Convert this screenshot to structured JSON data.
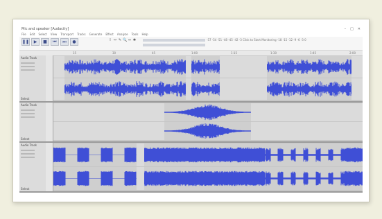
{
  "app": {
    "title": "Mic and speaker [Audacity]",
    "window_buttons": [
      "–",
      "□",
      "✕"
    ]
  },
  "menu": [
    "File",
    "Edit",
    "Select",
    "View",
    "Transport",
    "Tracks",
    "Generate",
    "Effect",
    "Analyze",
    "Tools",
    "Help"
  ],
  "transport": [
    {
      "name": "pause-icon",
      "glyph": "❚❚"
    },
    {
      "name": "play-icon",
      "glyph": "▶"
    },
    {
      "name": "stop-icon",
      "glyph": "■"
    },
    {
      "name": "skip-start-icon",
      "glyph": "⏮"
    },
    {
      "name": "skip-end-icon",
      "glyph": "⏭"
    },
    {
      "name": "record-icon",
      "glyph": "●"
    }
  ],
  "tools": [
    {
      "name": "select-tool-icon",
      "glyph": "I"
    },
    {
      "name": "envelope-tool-icon",
      "glyph": "↔"
    },
    {
      "name": "draw-tool-icon",
      "glyph": "✎"
    },
    {
      "name": "zoom-tool-icon",
      "glyph": "🔍"
    },
    {
      "name": "timeshift-tool-icon",
      "glyph": "⇔"
    },
    {
      "name": "multi-tool-icon",
      "glyph": "✱"
    }
  ],
  "meter_scale": "-57 -54 -51 -48 -45 -42 -3 Click to Start Monitoring -18 -15 -12 -9 -6 -3 0",
  "timeline_ticks": [
    "15",
    "30",
    "45",
    "1:00",
    "1:15",
    "1:30",
    "1:45",
    "2:00"
  ],
  "tracks": [
    {
      "name": "Audio Track",
      "label_bottom": "Select"
    },
    {
      "name": "Audio Track",
      "label_bottom": "Select"
    },
    {
      "name": "Audio Track",
      "label_bottom": "Select"
    }
  ],
  "colors": {
    "waveform": "#3f4fd6",
    "clip_bg": "#cfcfcf",
    "track_bg": "#c7c7c7"
  }
}
